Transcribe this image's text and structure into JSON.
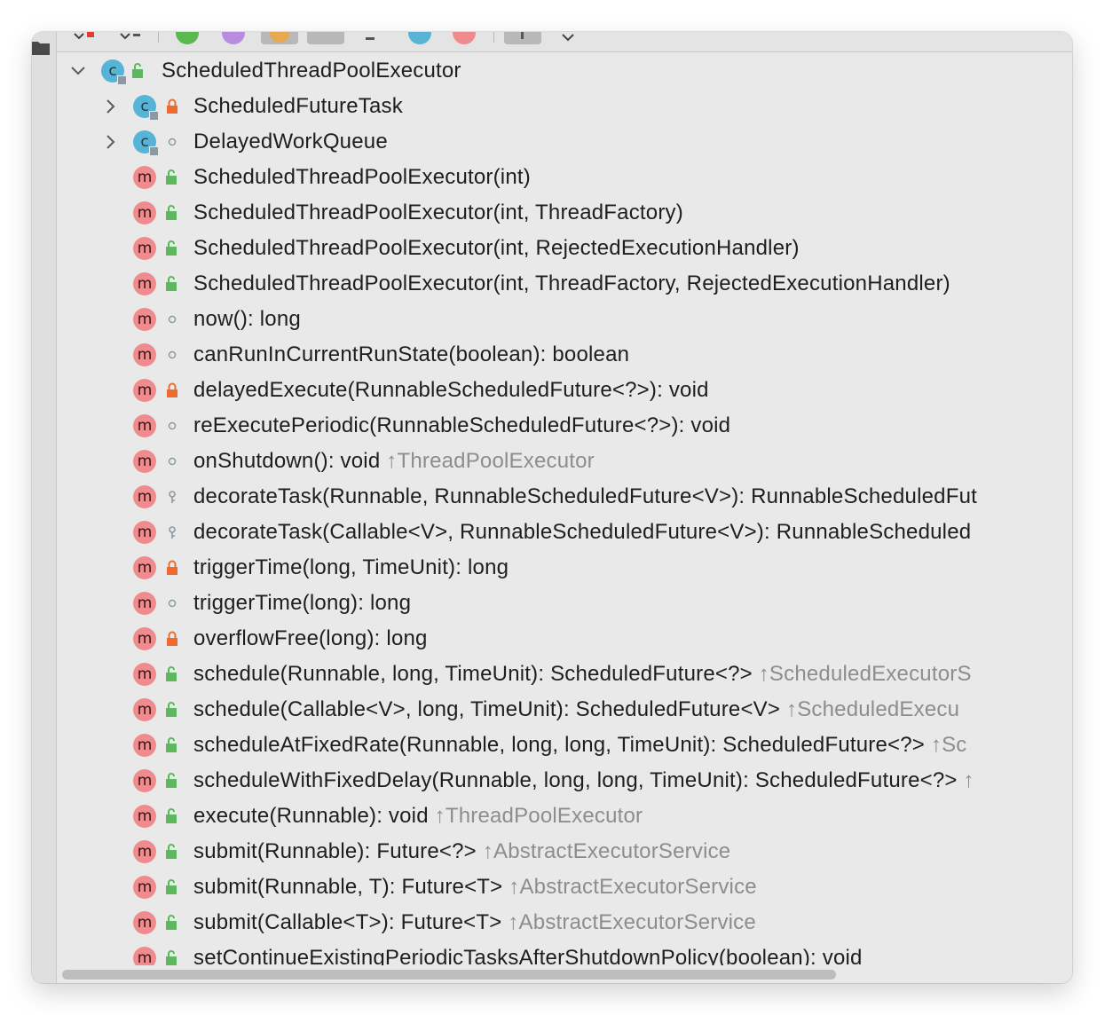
{
  "tree": {
    "root": {
      "label": "ScheduledThreadPoolExecutor",
      "kind_letter": "c",
      "expanded": true,
      "visibility": "public"
    },
    "items": [
      {
        "label": "ScheduledFutureTask",
        "kind": "class",
        "kind_letter": "c",
        "visibility": "private",
        "expandable": true,
        "inherited_from": ""
      },
      {
        "label": "DelayedWorkQueue",
        "kind": "class",
        "kind_letter": "c",
        "visibility": "package",
        "expandable": true,
        "inherited_from": ""
      },
      {
        "label": "ScheduledThreadPoolExecutor(int)",
        "kind": "method",
        "kind_letter": "m",
        "visibility": "public",
        "inherited_from": ""
      },
      {
        "label": "ScheduledThreadPoolExecutor(int, ThreadFactory)",
        "kind": "method",
        "kind_letter": "m",
        "visibility": "public",
        "inherited_from": ""
      },
      {
        "label": "ScheduledThreadPoolExecutor(int, RejectedExecutionHandler)",
        "kind": "method",
        "kind_letter": "m",
        "visibility": "public",
        "inherited_from": ""
      },
      {
        "label": "ScheduledThreadPoolExecutor(int, ThreadFactory, RejectedExecutionHandler)",
        "kind": "method",
        "kind_letter": "m",
        "visibility": "public",
        "inherited_from": ""
      },
      {
        "label": "now(): long",
        "kind": "method",
        "kind_letter": "m",
        "visibility": "package",
        "inherited_from": ""
      },
      {
        "label": "canRunInCurrentRunState(boolean): boolean",
        "kind": "method",
        "kind_letter": "m",
        "visibility": "package",
        "inherited_from": ""
      },
      {
        "label": "delayedExecute(RunnableScheduledFuture<?>): void",
        "kind": "method",
        "kind_letter": "m",
        "visibility": "private",
        "inherited_from": ""
      },
      {
        "label": "reExecutePeriodic(RunnableScheduledFuture<?>): void",
        "kind": "method",
        "kind_letter": "m",
        "visibility": "package",
        "inherited_from": ""
      },
      {
        "label": "onShutdown(): void",
        "kind": "method",
        "kind_letter": "m",
        "visibility": "package",
        "inherited_from": "↑ThreadPoolExecutor"
      },
      {
        "label": "decorateTask(Runnable, RunnableScheduledFuture<V>): RunnableScheduledFut",
        "kind": "method",
        "kind_letter": "m",
        "visibility": "protected",
        "inherited_from": ""
      },
      {
        "label": "decorateTask(Callable<V>, RunnableScheduledFuture<V>): RunnableScheduled",
        "kind": "method",
        "kind_letter": "m",
        "visibility": "protected",
        "inherited_from": ""
      },
      {
        "label": "triggerTime(long, TimeUnit): long",
        "kind": "method",
        "kind_letter": "m",
        "visibility": "private",
        "inherited_from": ""
      },
      {
        "label": "triggerTime(long): long",
        "kind": "method",
        "kind_letter": "m",
        "visibility": "package",
        "inherited_from": ""
      },
      {
        "label": "overflowFree(long): long",
        "kind": "method",
        "kind_letter": "m",
        "visibility": "private",
        "inherited_from": ""
      },
      {
        "label": "schedule(Runnable, long, TimeUnit): ScheduledFuture<?>",
        "kind": "method",
        "kind_letter": "m",
        "visibility": "public",
        "inherited_from": "↑ScheduledExecutorS"
      },
      {
        "label": "schedule(Callable<V>, long, TimeUnit): ScheduledFuture<V>",
        "kind": "method",
        "kind_letter": "m",
        "visibility": "public",
        "inherited_from": "↑ScheduledExecu"
      },
      {
        "label": "scheduleAtFixedRate(Runnable, long, long, TimeUnit): ScheduledFuture<?>",
        "kind": "method",
        "kind_letter": "m",
        "visibility": "public",
        "inherited_from": "↑Sc"
      },
      {
        "label": "scheduleWithFixedDelay(Runnable, long, long, TimeUnit): ScheduledFuture<?>",
        "kind": "method",
        "kind_letter": "m",
        "visibility": "public",
        "inherited_from": "↑"
      },
      {
        "label": "execute(Runnable): void",
        "kind": "method",
        "kind_letter": "m",
        "visibility": "public",
        "inherited_from": "↑ThreadPoolExecutor"
      },
      {
        "label": "submit(Runnable): Future<?>",
        "kind": "method",
        "kind_letter": "m",
        "visibility": "public",
        "inherited_from": "↑AbstractExecutorService"
      },
      {
        "label": "submit(Runnable, T): Future<T>",
        "kind": "method",
        "kind_letter": "m",
        "visibility": "public",
        "inherited_from": "↑AbstractExecutorService"
      },
      {
        "label": "submit(Callable<T>): Future<T>",
        "kind": "method",
        "kind_letter": "m",
        "visibility": "public",
        "inherited_from": "↑AbstractExecutorService"
      },
      {
        "label": "setContinueExistingPeriodicTasksAfterShutdownPolicy(boolean): void",
        "kind": "method",
        "kind_letter": "m",
        "visibility": "public",
        "inherited_from": ""
      }
    ]
  },
  "colors": {
    "background": "#e9e9e9",
    "class_icon": "#57b4d6",
    "method_icon": "#f08b8d",
    "public_lock": "#5cb85c",
    "private_lock": "#ee6a2e",
    "inherited_text": "#8d8d8d"
  }
}
